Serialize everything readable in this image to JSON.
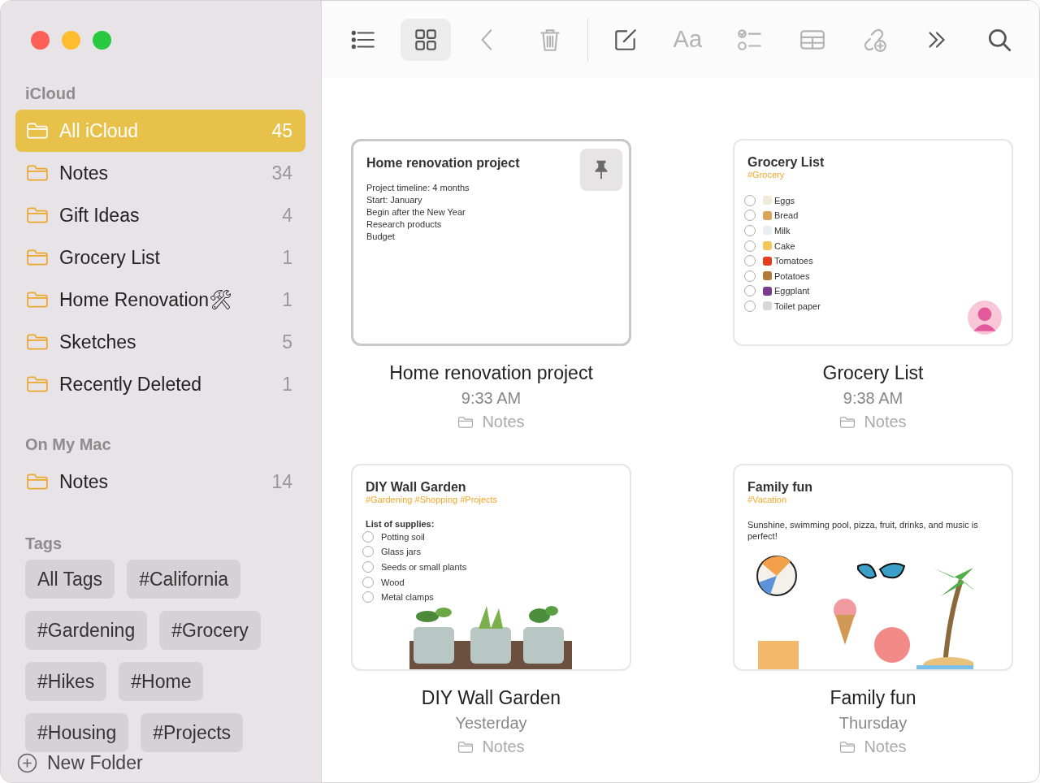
{
  "window": {
    "controls": [
      {
        "kind": "close"
      },
      {
        "kind": "minimize"
      },
      {
        "kind": "zoom"
      }
    ]
  },
  "sidebar": {
    "sections": [
      {
        "title": "iCloud",
        "folders": [
          {
            "name": "All iCloud",
            "count": "45",
            "selected": true
          },
          {
            "name": "Notes",
            "count": "34",
            "selected": false
          },
          {
            "name": "Gift Ideas",
            "count": "4",
            "selected": false
          },
          {
            "name": "Grocery List",
            "count": "1",
            "selected": false
          },
          {
            "name": "Home Renovation🛠",
            "count": "1",
            "selected": false
          },
          {
            "name": "Sketches",
            "count": "5",
            "selected": false
          },
          {
            "name": "Recently Deleted",
            "count": "1",
            "selected": false
          }
        ]
      },
      {
        "title": "On My Mac",
        "folders": [
          {
            "name": "Notes",
            "count": "14",
            "selected": false
          }
        ]
      }
    ],
    "tags": {
      "title": "Tags",
      "items": [
        "All Tags",
        "#California",
        "#Gardening",
        "#Grocery",
        "#Hikes",
        "#Home",
        "#Housing",
        "#Projects"
      ]
    },
    "new_folder": "New Folder"
  },
  "toolbar": [
    {
      "kind": "list",
      "selected": false,
      "disabled": false
    },
    {
      "kind": "grid",
      "selected": true,
      "disabled": false
    },
    {
      "kind": "back",
      "selected": false,
      "disabled": true
    },
    {
      "kind": "trash",
      "selected": false,
      "disabled": true
    },
    {
      "kind": "separator"
    },
    {
      "kind": "compose",
      "selected": false,
      "disabled": false
    },
    {
      "kind": "format",
      "label": "Aa",
      "selected": false,
      "disabled": true
    },
    {
      "kind": "checklist",
      "selected": false,
      "disabled": true
    },
    {
      "kind": "table",
      "selected": false,
      "disabled": true
    },
    {
      "kind": "collaborate",
      "selected": false,
      "disabled": true
    },
    {
      "kind": "more",
      "selected": false,
      "disabled": false
    },
    {
      "kind": "search",
      "selected": false,
      "disabled": false
    }
  ],
  "notes": [
    {
      "title": "Home renovation project",
      "selected": true,
      "pinned": true,
      "shared": false,
      "preview": {
        "title": "Home renovation project",
        "body": [
          "Project timeline: 4 months",
          "Start: January",
          "Begin after the New Year",
          "Research products",
          "Budget"
        ]
      },
      "time": "9:33 AM",
      "folder": "Notes"
    },
    {
      "title": "Grocery List",
      "selected": false,
      "pinned": false,
      "shared": true,
      "preview": {
        "title": "Grocery List",
        "tags": "#Grocery",
        "checklist": [
          {
            "label": "Eggs",
            "checked": false
          },
          {
            "label": "Bread",
            "checked": false
          },
          {
            "label": "Milk",
            "checked": false
          },
          {
            "label": "Cake",
            "checked": false
          },
          {
            "label": "Tomatoes",
            "checked": false
          },
          {
            "label": "Potatoes",
            "checked": false
          },
          {
            "label": "Eggplant",
            "checked": false
          },
          {
            "label": "Toilet paper",
            "checked": false
          }
        ]
      },
      "time": "9:38 AM",
      "folder": "Notes"
    },
    {
      "title": "DIY Wall Garden",
      "selected": false,
      "pinned": false,
      "shared": false,
      "preview": {
        "title": "DIY Wall Garden",
        "tags": "#Gardening #Shopping #Projects",
        "heading": "List of supplies:",
        "checklist": [
          {
            "label": "Potting soil",
            "checked": false
          },
          {
            "label": "Glass jars",
            "checked": false
          },
          {
            "label": "Seeds or small plants",
            "checked": false
          },
          {
            "label": "Wood",
            "checked": false
          },
          {
            "label": "Metal clamps",
            "checked": false
          }
        ],
        "picture": {
          "kind": "picture"
        }
      },
      "time": "Yesterday",
      "folder": "Notes"
    },
    {
      "title": "Family fun",
      "selected": false,
      "pinned": false,
      "shared": false,
      "preview": {
        "title": "Family fun",
        "tags": "#Vacation",
        "body": [
          "Sunshine, swimming pool, pizza, fruit, drinks, and music is perfect!"
        ],
        "picture": {
          "kind": "picture"
        }
      },
      "time": "Thursday",
      "folder": "Notes"
    }
  ]
}
